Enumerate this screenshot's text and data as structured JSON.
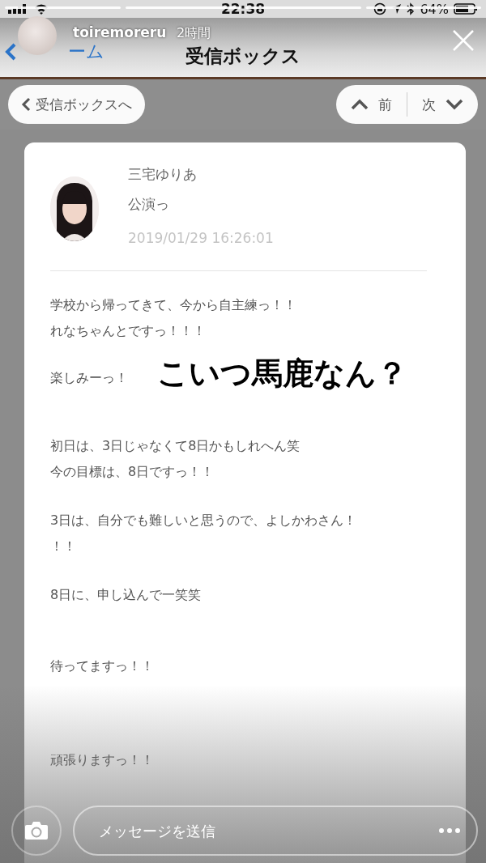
{
  "status_bar": {
    "time": "22:38",
    "battery": "64%"
  },
  "story": {
    "username": "toiremoreru",
    "time": "2時間"
  },
  "nav": {
    "back_label": "ーム",
    "title": "受信ボックス"
  },
  "toolbar": {
    "back_button": "受信ボックスへ",
    "prev_button": "前",
    "next_button": "次"
  },
  "message": {
    "sender": "三宅ゆりあ",
    "subject": "公演っ",
    "date": "2019/01/29 16:26:01",
    "paragraphs": [
      [
        "学校から帰ってきて、今から自主練っ！！",
        "れなちゃんとですっ！！！"
      ],
      [
        "楽しみーっ！"
      ],
      [
        "初日は、3日じゃなくて8日かもしれへん笑",
        "今の目標は、8日ですっ！！"
      ],
      [
        "3日は、自分でも難しいと思うので、よしかわさん！",
        "！！"
      ],
      [
        "8日に、申し込んで一笑笑"
      ],
      [
        "待ってますっ！！"
      ],
      [
        "頑張りますっ！！"
      ]
    ]
  },
  "sticker": {
    "text": "こいつ馬鹿なん？"
  },
  "reply_bar": {
    "placeholder": "メッセージを送信"
  }
}
